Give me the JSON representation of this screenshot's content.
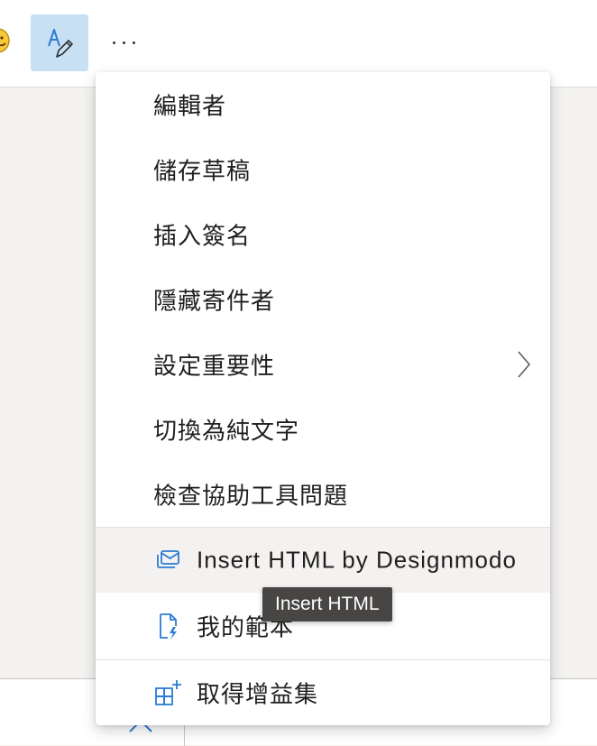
{
  "toolbar": {
    "emoji_icon": "emoji-icon",
    "editor_icon": "editor-pen-icon",
    "more_icon": "more-horizontal-icon"
  },
  "menu": {
    "items": [
      {
        "label": "編輯者"
      },
      {
        "label": "儲存草稿"
      },
      {
        "label": "插入簽名"
      },
      {
        "label": "隱藏寄件者"
      },
      {
        "label": "設定重要性",
        "has_submenu": true
      },
      {
        "label": "切換為純文字"
      },
      {
        "label": "檢查協助工具問題"
      },
      {
        "label": "Insert HTML by Designmodo",
        "icon": "envelope-stack-icon",
        "highlighted": true
      },
      {
        "label": "我的範本",
        "icon": "document-lightning-icon"
      },
      {
        "label": "取得增益集",
        "icon": "apps-add-icon"
      }
    ]
  },
  "tooltip": {
    "text": "Insert HTML"
  },
  "colors": {
    "accent": "#2b7cd3",
    "editor_button_bg": "#c7e0f4",
    "hover_bg": "#f3f2f1",
    "tooltip_bg": "#484644"
  }
}
